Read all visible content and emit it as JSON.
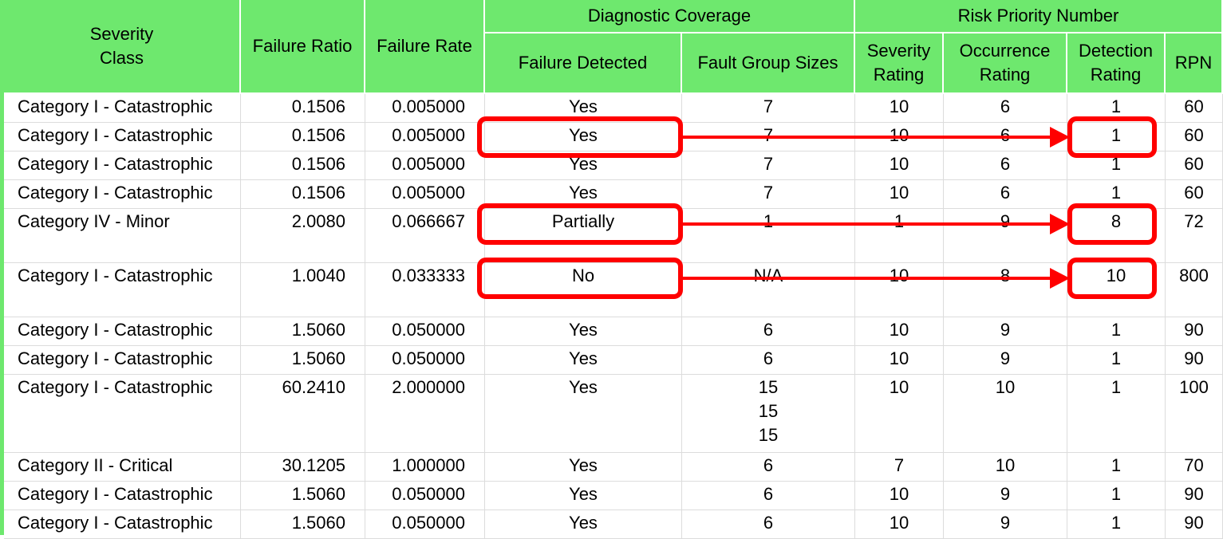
{
  "table": {
    "group_headers": {
      "diagnostic_coverage": "Diagnostic Coverage",
      "risk_priority_number": "Risk Priority Number"
    },
    "columns": [
      {
        "key": "severity_class",
        "label": "Severity\nClass"
      },
      {
        "key": "failure_ratio",
        "label": "Failure Ratio"
      },
      {
        "key": "failure_rate",
        "label": "Failure Rate"
      },
      {
        "key": "failure_detected",
        "label": "Failure Detected"
      },
      {
        "key": "fault_group_sizes",
        "label": "Fault Group Sizes"
      },
      {
        "key": "severity_rating",
        "label": "Severity\nRating"
      },
      {
        "key": "occurrence_rating",
        "label": "Occurrence\nRating"
      },
      {
        "key": "detection_rating",
        "label": "Detection\nRating"
      },
      {
        "key": "rpn",
        "label": "RPN"
      }
    ],
    "rows": [
      [
        "Category I - Catastrophic",
        "0.1506",
        "0.005000",
        "Yes",
        "7",
        "10",
        "6",
        "1",
        "60"
      ],
      [
        "Category I - Catastrophic",
        "0.1506",
        "0.005000",
        "Yes",
        "7",
        "10",
        "6",
        "1",
        "60"
      ],
      [
        "Category I - Catastrophic",
        "0.1506",
        "0.005000",
        "Yes",
        "7",
        "10",
        "6",
        "1",
        "60"
      ],
      [
        "Category I - Catastrophic",
        "0.1506",
        "0.005000",
        "Yes",
        "7",
        "10",
        "6",
        "1",
        "60"
      ],
      [
        "Category IV - Minor",
        "2.0080",
        "0.066667",
        "Partially",
        "1",
        "1",
        "9",
        "8",
        "72"
      ],
      [
        "Category I - Catastrophic",
        "1.0040",
        "0.033333",
        "No",
        "N/A",
        "10",
        "8",
        "10",
        "800"
      ],
      [
        "Category I - Catastrophic",
        "1.5060",
        "0.050000",
        "Yes",
        "6",
        "10",
        "9",
        "1",
        "90"
      ],
      [
        "Category I - Catastrophic",
        "1.5060",
        "0.050000",
        "Yes",
        "6",
        "10",
        "9",
        "1",
        "90"
      ],
      [
        "Category I - Catastrophic",
        "60.2410",
        "2.000000",
        "Yes",
        "15\n15\n15",
        "10",
        "10",
        "1",
        "100"
      ],
      [
        "Category II - Critical",
        "30.1205",
        "1.000000",
        "Yes",
        "6",
        "7",
        "10",
        "1",
        "70"
      ],
      [
        "Category I - Catastrophic",
        "1.5060",
        "0.050000",
        "Yes",
        "6",
        "10",
        "9",
        "1",
        "90"
      ],
      [
        "Category I - Catastrophic",
        "1.5060",
        "0.050000",
        "Yes",
        "6",
        "10",
        "9",
        "1",
        "90"
      ]
    ]
  },
  "annotations": {
    "highlight_color": "#ff0000",
    "highlighted_rows": [
      1,
      4,
      5
    ]
  }
}
